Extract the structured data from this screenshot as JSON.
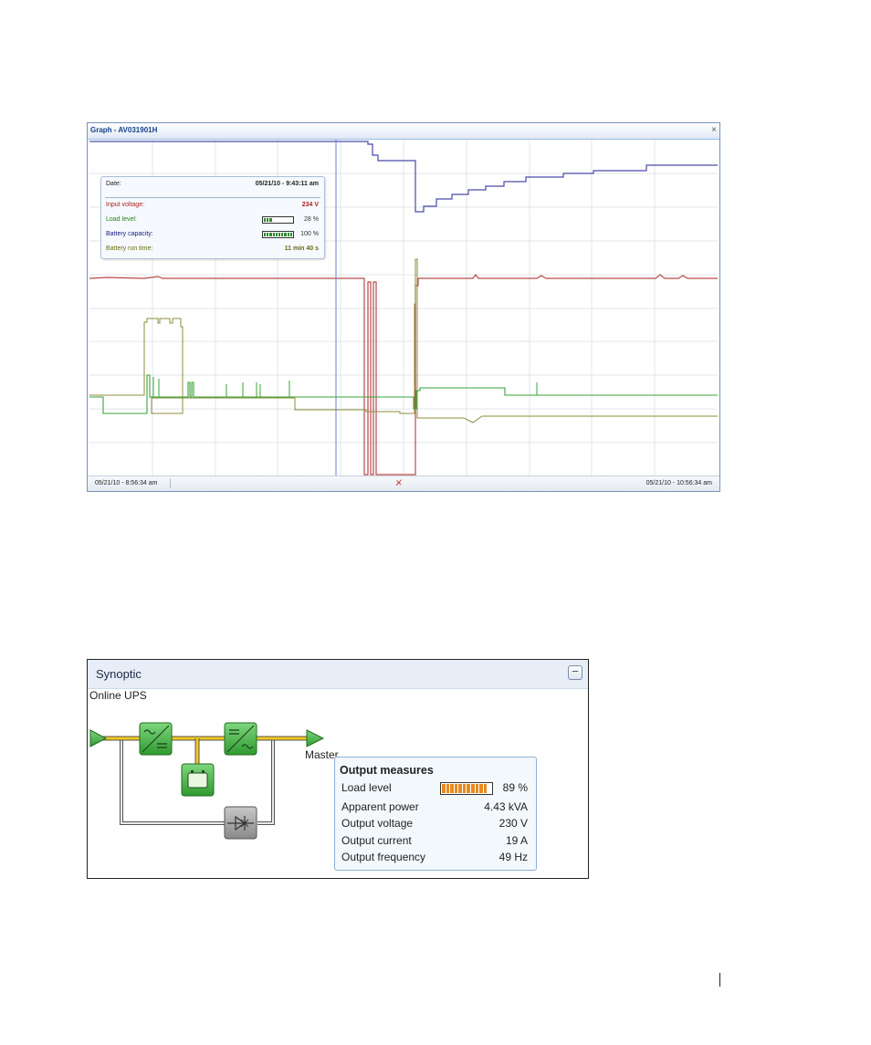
{
  "graph": {
    "title": "Graph - AV031901H",
    "close_label": "×",
    "start_time": "05/21/10 - 8:56:34 am",
    "end_time": "05/21/10 - 10:56:34 am",
    "status_icon": "chart-reset-icon",
    "tooltip": {
      "date_label": "Date:",
      "date_value": "05/21/10 - 9:43:11 am",
      "rows": [
        {
          "label": "Input voltage:",
          "value": "234 V",
          "color": "#b02020"
        },
        {
          "label": "Load level:",
          "value": "28 %",
          "color": "#208020",
          "bar_fraction": 0.28
        },
        {
          "label": "Battery capacity:",
          "value": "100 %",
          "color": "#1a1a80",
          "bar_fraction": 1.0
        },
        {
          "label": "Battery run time:",
          "value": "11 min 40 s",
          "color": "#6b6b10"
        }
      ]
    },
    "colors": {
      "input_voltage": "#b84a4a",
      "load_level": "#3aa33a",
      "battery_capacity": "#4a4aa8",
      "battery_runtime": "#8c8c3c",
      "cursor": "#6a7fd0"
    }
  },
  "synoptic": {
    "title": "Synoptic",
    "collapse_label": "−",
    "subtitle": "Online UPS",
    "master_label": "Master",
    "icons": [
      "input-arrow-icon",
      "rectifier-icon",
      "inverter-icon",
      "battery-icon",
      "bypass-icon",
      "output-arrow-icon"
    ],
    "measures": {
      "title": "Output measures",
      "rows": [
        {
          "label": "Load level",
          "value": "89 %",
          "bar_fraction": 0.89
        },
        {
          "label": "Apparent power",
          "value": "4.43 kVA"
        },
        {
          "label": "Output voltage",
          "value": "230 V"
        },
        {
          "label": "Output current",
          "value": "19 A"
        },
        {
          "label": "Output frequency",
          "value": "49 Hz"
        }
      ]
    }
  }
}
